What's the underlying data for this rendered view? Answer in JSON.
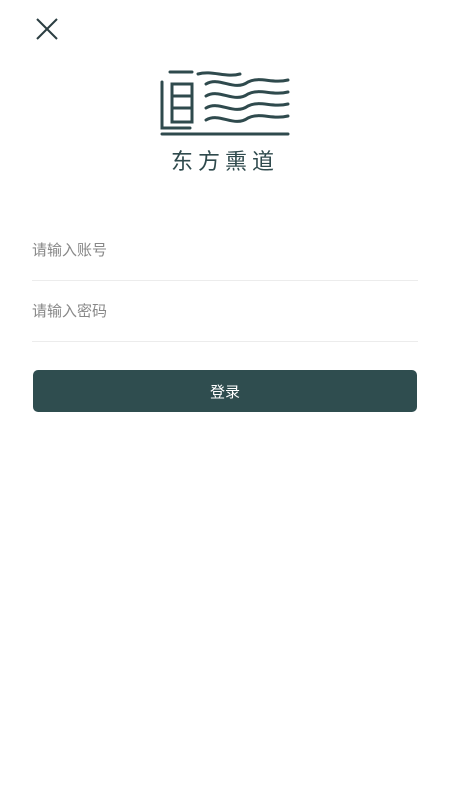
{
  "logo": {
    "text": "东方熏道"
  },
  "form": {
    "account_placeholder": "请输入账号",
    "password_placeholder": "请输入密码",
    "account_value": "",
    "password_value": "",
    "login_label": "登录"
  },
  "colors": {
    "primary": "#2f4d4f",
    "divider": "#ececec",
    "placeholder": "#888888",
    "background": "#ffffff"
  },
  "icons": {
    "close": "close-icon",
    "logo_mark": "logo-mark-icon"
  }
}
